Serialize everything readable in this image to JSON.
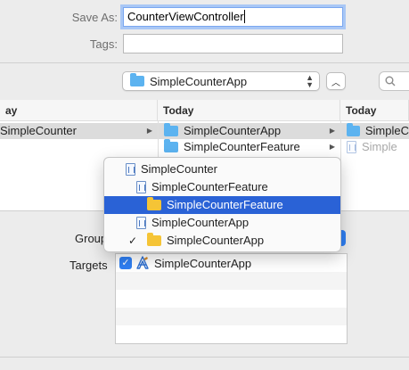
{
  "save_as": {
    "label": "Save As:",
    "value": "CounterViewController"
  },
  "tags": {
    "label": "Tags:",
    "value": ""
  },
  "location": {
    "current": "SimpleCounterApp"
  },
  "search": {
    "placeholder": "Q"
  },
  "browser": {
    "columns": [
      {
        "header": "ay",
        "items": [
          {
            "label": "SimpleCounter",
            "selected": true,
            "icon": "folder-icon-partial"
          }
        ]
      },
      {
        "header": "Today",
        "items": [
          {
            "label": "SimpleCounterApp",
            "selected": true,
            "icon": "folder-icon"
          },
          {
            "label": "SimpleCounterFeature",
            "selected": false,
            "icon": "folder-icon"
          }
        ]
      },
      {
        "header": "Today",
        "items": [
          {
            "label": "SimpleC",
            "selected": true,
            "icon": "folder-icon"
          },
          {
            "label": "Simple",
            "selected": false,
            "icon": "document-icon"
          }
        ]
      }
    ]
  },
  "group": {
    "label": "Group"
  },
  "targets": {
    "label": "Targets",
    "items": [
      {
        "label": "SimpleCounterApp",
        "checked": true
      }
    ]
  },
  "group_menu": {
    "items": [
      {
        "label": "SimpleCounter",
        "icon": "project-icon",
        "checked": false,
        "highlighted": false
      },
      {
        "label": "SimpleCounterFeature",
        "icon": "project-icon",
        "checked": false,
        "highlighted": false
      },
      {
        "label": "SimpleCounterFeature",
        "icon": "folder-icon",
        "checked": false,
        "highlighted": true
      },
      {
        "label": "SimpleCounterApp",
        "icon": "project-icon",
        "checked": false,
        "highlighted": false
      },
      {
        "label": "SimpleCounterApp",
        "icon": "folder-icon",
        "checked": true,
        "highlighted": false
      }
    ],
    "check_glyph": "✓"
  },
  "colors": {
    "highlight": "#2a62d6",
    "accent": "#2f7ff3",
    "folder_blue": "#5cb3f0",
    "folder_yellow": "#f5c436"
  }
}
